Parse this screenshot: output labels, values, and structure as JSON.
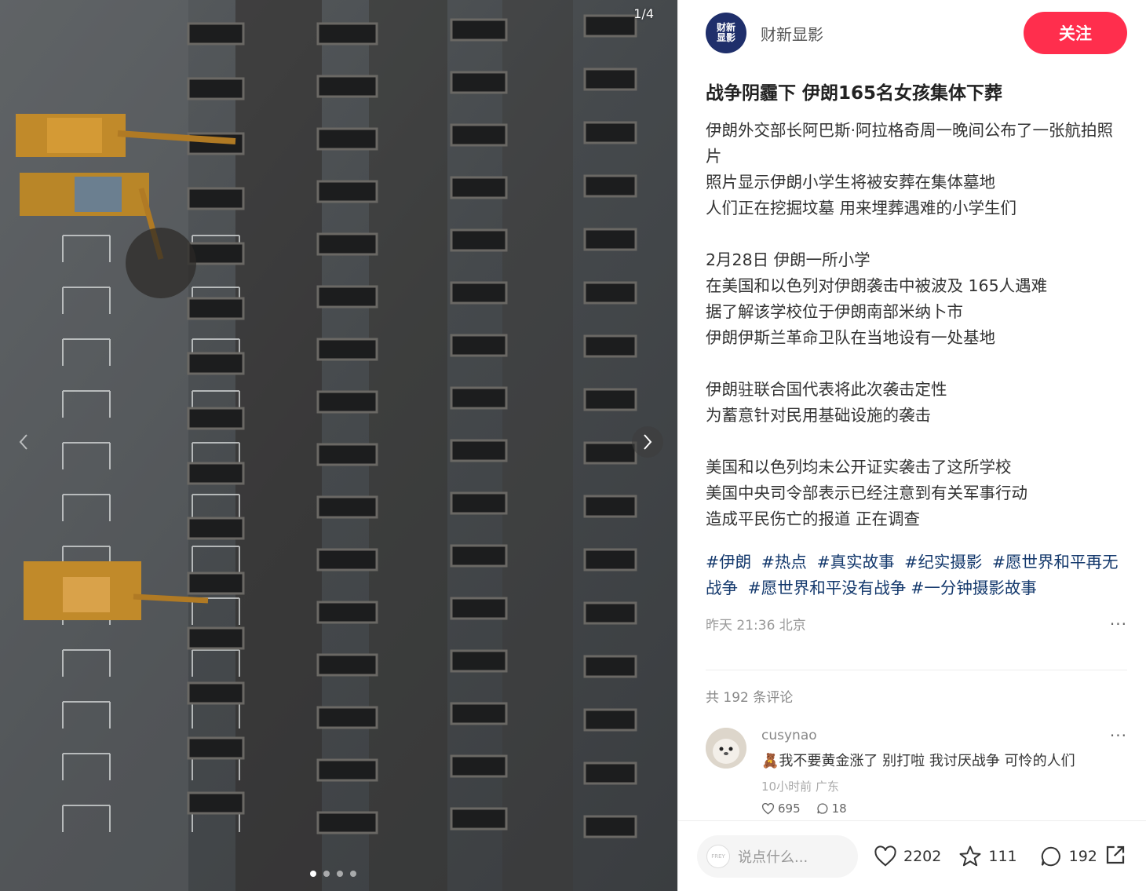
{
  "media": {
    "counter": "1/4",
    "dots": 4,
    "active_dot": 1
  },
  "author": {
    "avatar_text_line1": "财新",
    "avatar_text_line2": "显影",
    "name": "财新显影",
    "follow_label": "关注"
  },
  "post": {
    "title": "战争阴霾下 伊朗165名女孩集体下葬",
    "body": "伊朗外交部长阿巴斯·阿拉格奇周一晚间公布了一张航拍照片\n照片显示伊朗小学生将被安葬在集体墓地\n人们正在挖掘坟墓 用来埋葬遇难的小学生们\n\n2月28日 伊朗一所小学\n在美国和以色列对伊朗袭击中被波及 165人遇难\n据了解该学校位于伊朗南部米纳卜市\n伊朗伊斯兰革命卫队在当地设有一处基地\n\n伊朗驻联合国代表将此次袭击定性\n为蓄意针对民用基础设施的袭击\n\n美国和以色列均未公开证实袭击了这所学校\n美国中央司令部表示已经注意到有关军事行动\n造成平民伤亡的报道 正在调查",
    "tags": [
      "#伊朗",
      "#热点",
      "#真实故事",
      "#纪实摄影",
      "#愿世界和平再无战争",
      "#愿世界和平没有战争",
      "#一分钟摄影故事"
    ],
    "meta": "昨天 21:36 北京",
    "more": "···"
  },
  "comments": {
    "count_label": "共 192 条评论",
    "items": [
      {
        "name": "cusynao",
        "text": "🧸我不要黄金涨了 别打啦 我讨厌战争 可怜的人们",
        "meta": "10小时前 广东",
        "likes": "695",
        "replies": "18",
        "more": "···"
      }
    ]
  },
  "bottom_bar": {
    "input_placeholder": "说点什么...",
    "input_avatar_text": "FREY",
    "likes": "2202",
    "collects": "111",
    "comments": "192"
  },
  "colors": {
    "follow": "#ff2e4d",
    "tag": "#13386c",
    "brand_avatar": "#1f2f6b"
  }
}
